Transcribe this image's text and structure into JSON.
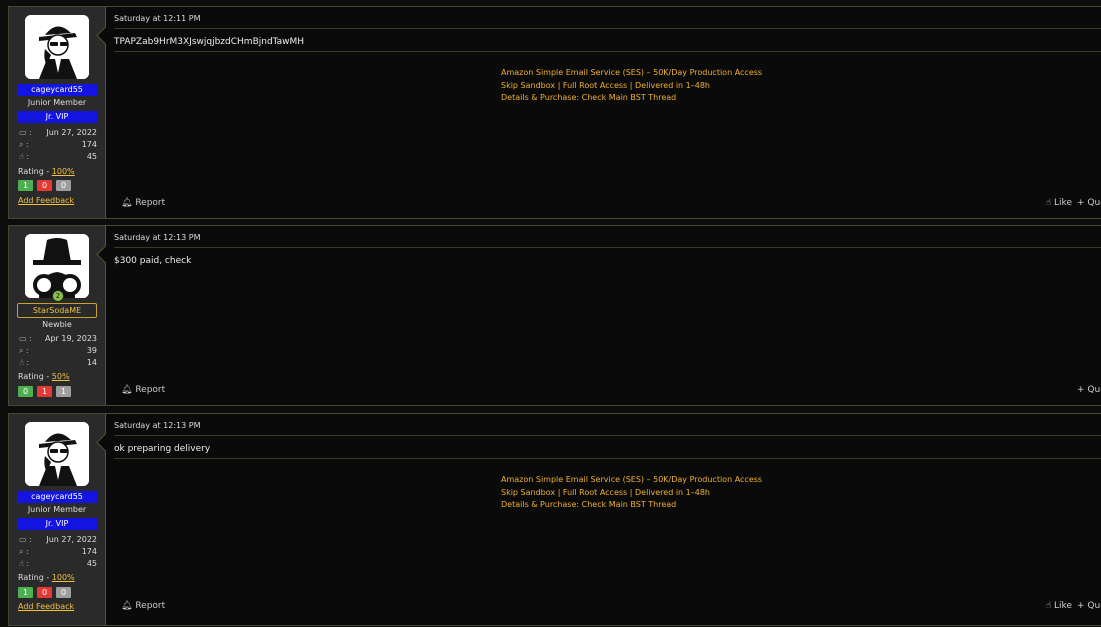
{
  "posts": [
    {
      "user": {
        "name": "cageycard55",
        "role": "Junior Member",
        "tag": "Jr. VIP",
        "joined": "Jun 27, 2022",
        "messages": "174",
        "reactions": "45",
        "rating_label": "Rating - ",
        "rating": "100%",
        "fb_pos": "1",
        "fb_neg": "0",
        "fb_neu": "0",
        "add_feedback": "Add Feedback"
      },
      "timestamp": "Saturday at 12:11 PM",
      "message": "TPAPZab9HrM3XJswjqjbzdCHmBjndTawMH",
      "promo": {
        "line1": "Amazon Simple Email Service (SES) – 50K/Day Production Access",
        "line2": "Skip Sandbox | Full Root Access | Delivered in 1–48h",
        "line3": "Details & Purchase: Check Main BST Thread"
      },
      "report": "Report",
      "like": "Like",
      "quote": "Quote"
    },
    {
      "user": {
        "name": "StarSodaME",
        "role": "Newbie",
        "joined": "Apr 19, 2023",
        "messages": "39",
        "reactions": "14",
        "rating_label": "Rating - ",
        "rating": "50%",
        "fb_pos": "0",
        "fb_neg": "1",
        "fb_neu": "1",
        "online": "2"
      },
      "timestamp": "Saturday at 12:13 PM",
      "message": "$300 paid, check",
      "report": "Report",
      "quote": "Quote"
    },
    {
      "user": {
        "name": "cageycard55",
        "role": "Junior Member",
        "tag": "Jr. VIP",
        "joined": "Jun 27, 2022",
        "messages": "174",
        "reactions": "45",
        "rating_label": "Rating - ",
        "rating": "100%",
        "fb_pos": "1",
        "fb_neg": "0",
        "fb_neu": "0",
        "add_feedback": "Add Feedback"
      },
      "timestamp": "Saturday at 12:13 PM",
      "message": "ok preparing delivery",
      "promo": {
        "line1": "Amazon Simple Email Service (SES) – 50K/Day Production Access",
        "line2": "Skip Sandbox | Full Root Access | Delivered in 1–48h",
        "line3": "Details & Purchase: Check Main BST Thread"
      },
      "report": "Report",
      "like": "Like",
      "quote": "Quote"
    }
  ],
  "icons": {
    "joined": "calendar-icon",
    "messages": "messages-icon",
    "reactions": "thumbs-up-icon",
    "report": "bell-icon",
    "like": "thumbs-up-icon",
    "quote": "plus-icon"
  }
}
